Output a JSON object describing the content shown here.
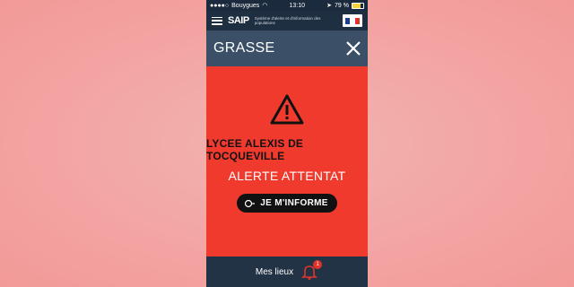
{
  "status": {
    "carrier": "Bouygues",
    "time": "13:10",
    "battery_text": "79 %",
    "battery_level": 0.79
  },
  "app": {
    "logo_text": "SAIP",
    "logo_subtitle": "Système d'alerte et d'information des populations"
  },
  "city": {
    "name": "GRASSE"
  },
  "alert": {
    "place": "LYCEE ALEXIS DE TOCQUEVILLE",
    "type": "ALERTE ATTENTAT",
    "button_label": "JE M'INFORME"
  },
  "bottom": {
    "mes_lieux": "Mes lieux",
    "badge_count": "1"
  },
  "colors": {
    "alert_red": "#f03a2e",
    "navy": "#223346",
    "city_bar": "#3b4f66"
  }
}
